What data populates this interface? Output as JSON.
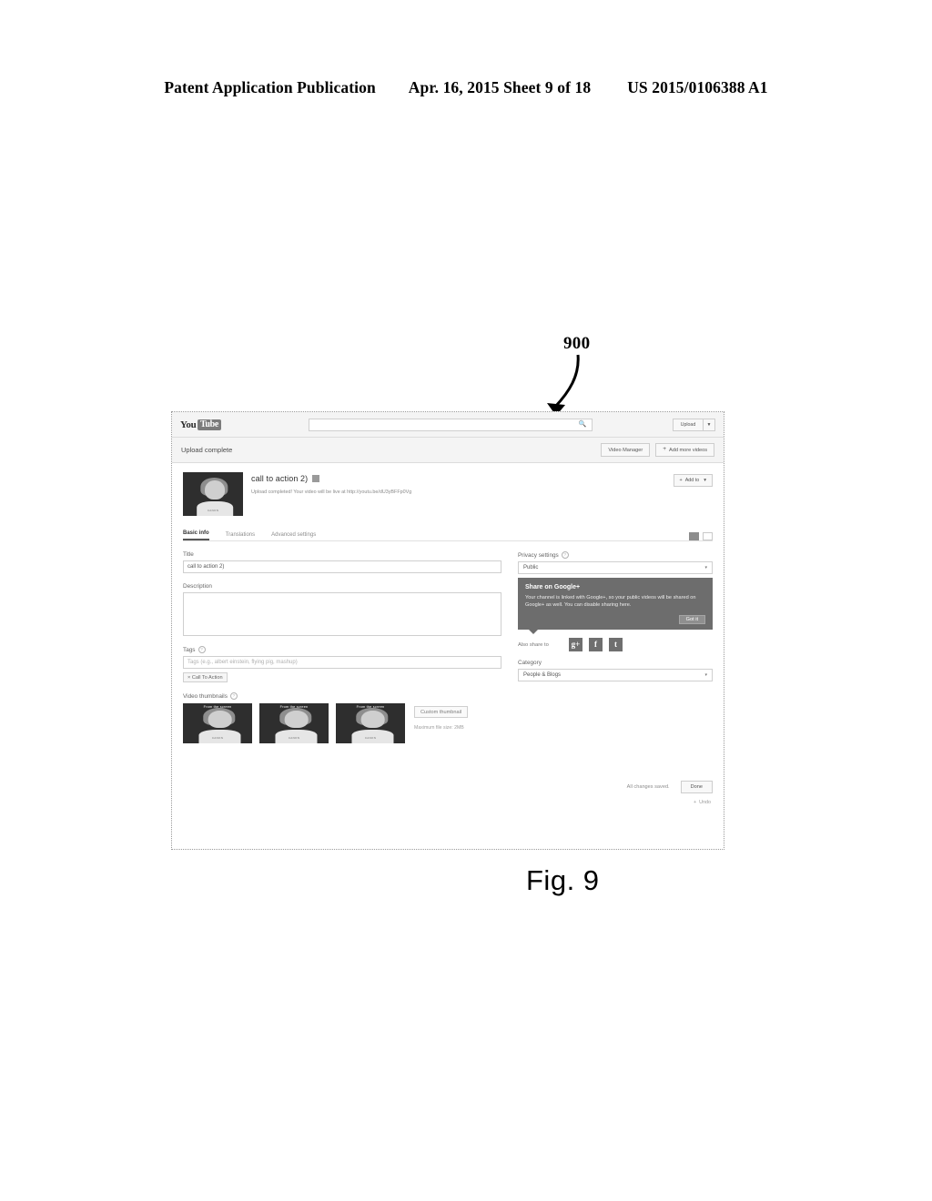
{
  "patent": {
    "publication": "Patent Application Publication",
    "date_sheet": "Apr. 16, 2015  Sheet 9 of 18",
    "number": "US 2015/0106388 A1",
    "figure_reference": "900",
    "figure_caption": "Fig. 9"
  },
  "screenshot": {
    "masthead": {
      "logo_you": "You",
      "logo_tube": "Tube",
      "search_placeholder": "",
      "search_value": "",
      "search_icon": "search-icon",
      "upload_label": "Upload",
      "upload_caret": "▼"
    },
    "upload_bar": {
      "status": "Upload complete",
      "video_manager_label": "Video Manager",
      "add_more_plus": "+",
      "add_more_label": "Add more videos"
    },
    "video": {
      "title": "call to action 2)",
      "edit_icon": "pencil-icon",
      "subtitle": "Upload completed! Your video will be live at http://youtu.be/dU3yBFFp0Vg",
      "thumbnail_banner": "From the screen",
      "thumbnail_caption": "CANON",
      "add_to_plus": "+",
      "add_to_label": "Add to",
      "add_to_caret": "▾"
    },
    "tabs": [
      {
        "label": "Basic info",
        "active": true
      },
      {
        "label": "Translations",
        "active": false
      },
      {
        "label": "Advanced settings",
        "active": false
      }
    ],
    "tab_icons": [
      "grid-view-icon",
      "list-view-icon"
    ],
    "form": {
      "title_label": "Title",
      "title_value": "call to action 2)",
      "description_label": "Description",
      "description_value": "",
      "tags_label": "Tags",
      "tags_help_icon": "help-icon",
      "tags_placeholder": "Tags (e.g., albert einstein, flying pig, mashup)",
      "tag_chip": "× Call To Action",
      "thumbnails_label": "Video thumbnails",
      "thumbnails_help_icon": "help-icon",
      "custom_thumbnail_label": "Custom thumbnail",
      "thumbnail_note": "Maximum file size: 2MB"
    },
    "privacy": {
      "label": "Privacy settings",
      "help_icon": "help-icon",
      "value": "Public",
      "caret": "▾"
    },
    "gplus_popup": {
      "title": "Share on Google+",
      "body": "Your channel is linked with Google+, so your public videos will be shared on Google+ as well. You can disable sharing here.",
      "got_it_label": "Got it"
    },
    "share": {
      "label": "Also share to",
      "icons": [
        {
          "name": "google-plus-icon",
          "glyph": "g+"
        },
        {
          "name": "facebook-icon",
          "glyph": "f"
        },
        {
          "name": "twitter-icon",
          "glyph": "t"
        }
      ]
    },
    "category": {
      "label": "Category",
      "value": "People & Blogs",
      "caret": "▾"
    },
    "footer": {
      "saved_text": "All changes saved.",
      "done_label": "Done",
      "undo_plus": "+",
      "undo_label": "Undo"
    }
  }
}
